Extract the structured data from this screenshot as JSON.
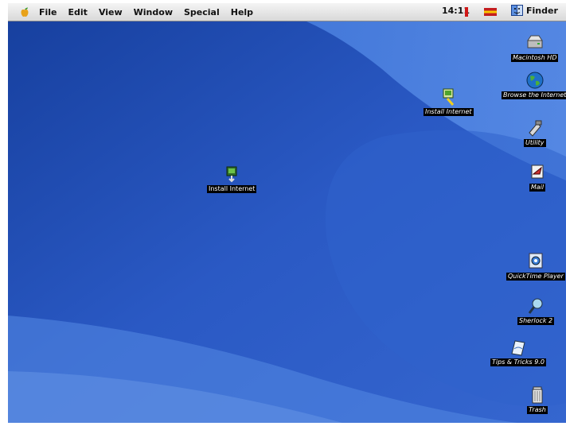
{
  "menubar": {
    "items": [
      "File",
      "Edit",
      "View",
      "Window",
      "Special",
      "Help"
    ],
    "clock": "14:11",
    "app_menu": "Finder"
  },
  "desktop": {
    "dragged_icon": "Install Internet",
    "drag_target_icon": "Install Internet",
    "icons": {
      "hd": "Macintosh HD",
      "browse": "Browse the Internet",
      "mail": "Mail",
      "utility": "Utility",
      "quicktime": "QuickTime Player",
      "sherlock": "Sherlock 2",
      "tips": "Tips & Tricks 9.0",
      "trash": "Trash"
    }
  },
  "colors": {
    "desktop": "#2b5cc8",
    "menubar": "#e6e6e6"
  }
}
